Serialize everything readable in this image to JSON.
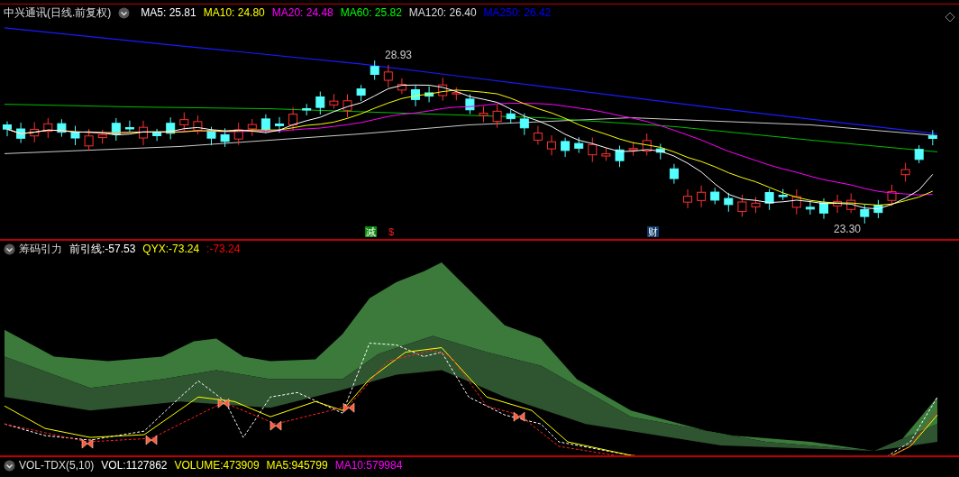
{
  "main_panel": {
    "title": "中兴通讯(日线.前复权)",
    "indicators": [
      {
        "label": "MA5: 25.81",
        "color": "#ffffff"
      },
      {
        "label": "MA10: 24.80",
        "color": "#ffff00"
      },
      {
        "label": "MA20: 24.48",
        "color": "#ff00ff"
      },
      {
        "label": "MA60: 25.82",
        "color": "#00ff00"
      },
      {
        "label": "MA120: 26.40",
        "color": "#dddddd"
      },
      {
        "label": "MA250: 26.42",
        "color": "#0000ff"
      }
    ],
    "price_labels": [
      {
        "text": "28.93"
      },
      {
        "text": "23.30"
      }
    ],
    "event_markers": [
      {
        "text": "减",
        "kind": "reduce"
      },
      {
        "text": "$",
        "kind": "dividend"
      },
      {
        "text": "财",
        "kind": "finance"
      }
    ]
  },
  "indicator_panel": {
    "title": "筹码引力",
    "values": [
      {
        "label": "前引线:-57.53",
        "color": "#ffffff"
      },
      {
        "label": "QYX:-73.24",
        "color": "#ffff00"
      },
      {
        "label": ":-73.24",
        "color": "#ff0000"
      }
    ]
  },
  "volume_panel": {
    "title": "VOL-TDX(5,10)",
    "values": [
      {
        "label": "VOL:1127862",
        "color": "#ffffff"
      },
      {
        "label": "VOLUME:473909",
        "color": "#ffff00"
      },
      {
        "label": "MA5:945799",
        "color": "#ffff00"
      },
      {
        "label": "MA10:579984",
        "color": "#ff00ff"
      }
    ]
  }
}
